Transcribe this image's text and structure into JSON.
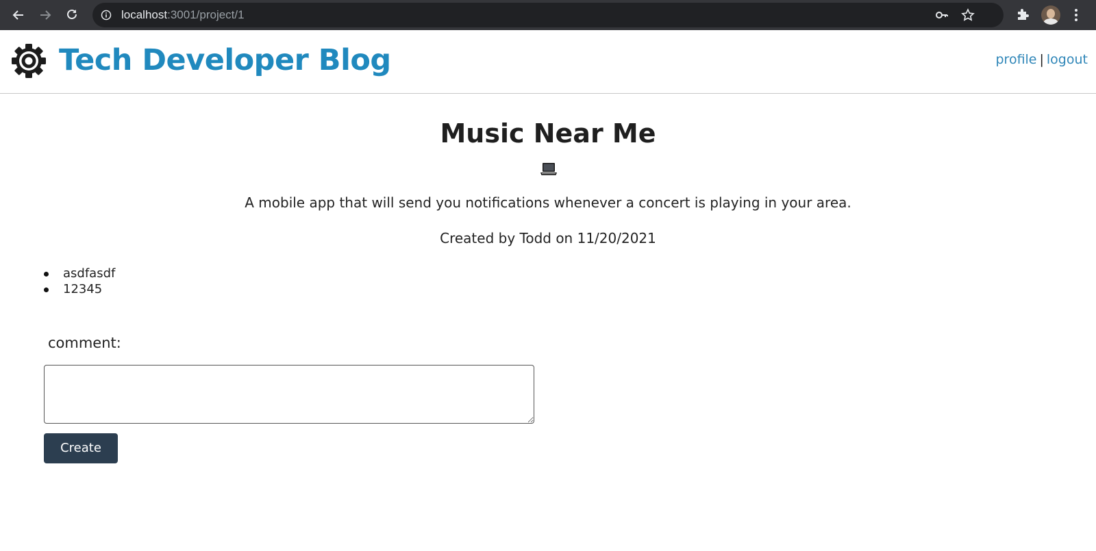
{
  "browser": {
    "url_host": "localhost",
    "url_path": ":3001/project/1",
    "icons": [
      "back-arrow-icon",
      "forward-arrow-icon",
      "reload-icon",
      "info-icon",
      "key-icon",
      "star-icon",
      "puzzle-icon",
      "avatar",
      "kebab-menu-icon"
    ]
  },
  "header": {
    "title": "Tech Developer Blog",
    "logo_icon": "gear-icon",
    "nav": {
      "profile_label": "profile",
      "separator": "|",
      "logout_label": "logout"
    },
    "colors": {
      "title": "#2089be",
      "link": "#2f86b8"
    }
  },
  "post": {
    "title": "Music Near Me",
    "icon": "laptop-icon",
    "description": "A mobile app that will send you notifications whenever a concert is playing in your area.",
    "meta": "Created by Todd on 11/20/2021"
  },
  "comments": [
    {
      "text": "asdfasdf"
    },
    {
      "text": "12345"
    }
  ],
  "comment_form": {
    "label": "comment:",
    "value": "",
    "submit_label": "Create",
    "button_color": "#2c3e50"
  }
}
